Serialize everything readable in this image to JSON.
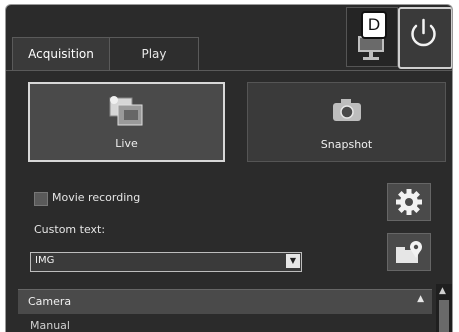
{
  "tabs": [
    {
      "label": "Acquisition",
      "active": true
    },
    {
      "label": "Play",
      "active": false
    }
  ],
  "toolbar": {
    "monitor_icon": "monitor-icon",
    "power_icon": "power-icon",
    "callout_label": "D"
  },
  "capture": {
    "live_label": "Live",
    "snapshot_label": "Snapshot"
  },
  "recording": {
    "movie_recording_label": "Movie recording",
    "movie_recording_checked": false
  },
  "custom_text": {
    "label": "Custom text:",
    "value": "IMG"
  },
  "camera_section": {
    "title": "Camera",
    "first_item": "Manual"
  },
  "icons": {
    "settings": "gear-icon",
    "save_location": "folder-pin-icon"
  },
  "colors": {
    "background": "#2b2b2b",
    "button": "#3c3c3c",
    "highlight_border": "#d8d8d8"
  }
}
